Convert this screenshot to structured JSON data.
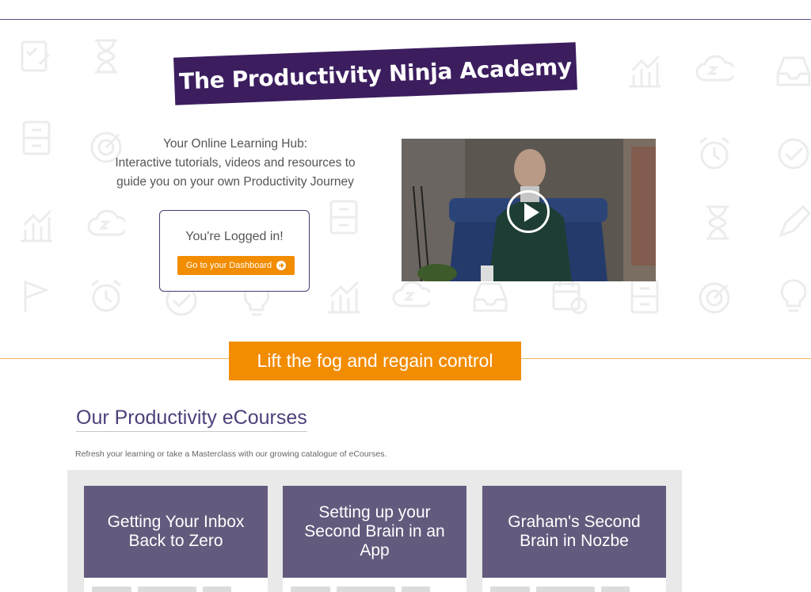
{
  "hero": {
    "title": "The Productivity Ninja Academy",
    "hub_lines": [
      "Your Online Learning Hub:",
      "Interactive tutorials, videos and resources to",
      "guide you on your own Productivity Journey"
    ],
    "logged_in_text": "You're Logged in!",
    "dashboard_button": "Go to your Dashboard",
    "video_play_icon": "play-icon"
  },
  "banner": {
    "text": "Lift the fog and regain control"
  },
  "courses": {
    "heading": "Our Productivity eCourses",
    "subheading": "Refresh your learning or take a Masterclass with our growing catalogue of eCourses.",
    "items": [
      {
        "title": "Getting Your Inbox Back to Zero"
      },
      {
        "title": "Setting up your Second Brain in an App"
      },
      {
        "title": "Graham's Second Brain in Nozbe"
      }
    ]
  },
  "colors": {
    "brand_purple": "#3c1e5f",
    "accent_orange": "#f28c00",
    "card_purple": "#635a7d"
  }
}
